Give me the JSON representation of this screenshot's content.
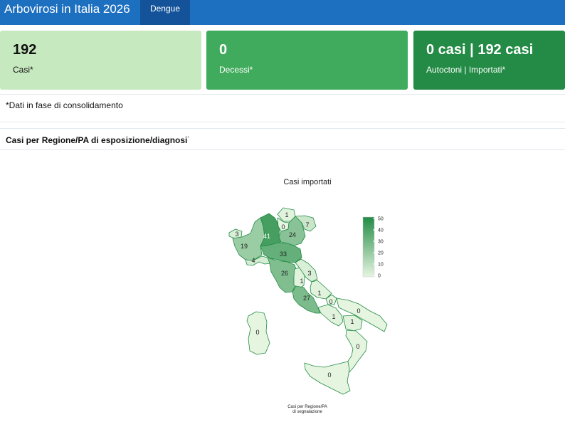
{
  "header": {
    "title": "Arbovirosi in Italia 2026",
    "active_tab": "Dengue"
  },
  "cards": [
    {
      "value": "192",
      "label": "Casi*"
    },
    {
      "value": "0",
      "label": "Decessi*"
    },
    {
      "value": "0 casi | 192 casi",
      "label": "Autoctoni | Importati*"
    }
  ],
  "note": "*Dati in fase di consolidamento",
  "section": {
    "title": "Casi per Regione/PA di esposizione/diagnosi",
    "marker": "*"
  },
  "chart_data": {
    "type": "choropleth",
    "title": "Casi importati",
    "caption_line1": "Casi per Regione/PA",
    "caption_line2": "di segnalazione",
    "legend": {
      "ticks": [
        "50",
        "40",
        "30",
        "20",
        "10",
        "0"
      ],
      "range": [
        0,
        50
      ],
      "low_color": "#e5f5e0",
      "high_color": "#238b45"
    },
    "regions": [
      {
        "name": "Valle d'Aosta",
        "label": "3",
        "value": 3
      },
      {
        "name": "Piemonte",
        "label": "19",
        "value": 19
      },
      {
        "name": "Liguria",
        "label": "4",
        "value": 4
      },
      {
        "name": "Lombardia",
        "label": "41",
        "value": 41
      },
      {
        "name": "Trentino-Alto Adige",
        "label": "1",
        "value": 1
      },
      {
        "name": "Trentino",
        "label": "0",
        "value": 0
      },
      {
        "name": "Veneto",
        "label": "24",
        "value": 24
      },
      {
        "name": "Friuli Venezia Giulia",
        "label": "7",
        "value": 7
      },
      {
        "name": "Emilia-Romagna",
        "label": "33",
        "value": 33
      },
      {
        "name": "Toscana",
        "label": "26",
        "value": 26
      },
      {
        "name": "Umbria",
        "label": "1",
        "value": 1
      },
      {
        "name": "Marche",
        "label": "3",
        "value": 3
      },
      {
        "name": "Lazio",
        "label": "27",
        "value": 27
      },
      {
        "name": "Abruzzo",
        "label": "1",
        "value": 1
      },
      {
        "name": "Molise",
        "label": "0",
        "value": 0
      },
      {
        "name": "Campania",
        "label": "1",
        "value": 1
      },
      {
        "name": "Puglia",
        "label": "0",
        "value": 0
      },
      {
        "name": "Basilicata",
        "label": "1",
        "value": 1
      },
      {
        "name": "Calabria",
        "label": "0",
        "value": 0
      },
      {
        "name": "Sicilia",
        "label": "0",
        "value": 0
      },
      {
        "name": "Sardegna",
        "label": "0",
        "value": 0
      }
    ]
  }
}
